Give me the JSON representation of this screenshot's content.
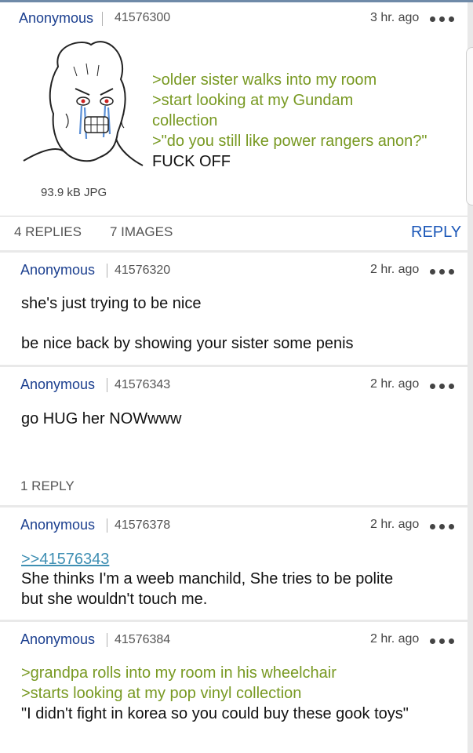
{
  "op": {
    "name": "Anonymous",
    "post_id": "41576300",
    "time": "3 hr. ago",
    "lines": [
      ">older sister walks into my room",
      ">start looking at my Gundam",
      "collection",
      ">\"do you still like power rangers anon?\"",
      "FUCK OFF"
    ],
    "file_info": "93.9 kB JPG",
    "replies": "4 REPLIES",
    "images": "7 IMAGES",
    "reply_label": "REPLY"
  },
  "posts": [
    {
      "name": "Anonymous",
      "post_id": "41576320",
      "time": "2 hr. ago",
      "lines": [
        "she's just trying to be nice",
        "be nice back by showing your sister some penis"
      ]
    },
    {
      "name": "Anonymous",
      "post_id": "41576343",
      "time": "2 hr. ago",
      "lines": [
        "go HUG her NOWwww"
      ],
      "replies": "1 REPLY"
    },
    {
      "name": "Anonymous",
      "post_id": "41576378",
      "time": "2 hr. ago",
      "quote_link": ">>41576343",
      "lines": [
        "She thinks I'm a weeb manchild, She tries to be polite",
        "but she wouldn't touch me."
      ]
    },
    {
      "name": "Anonymous",
      "post_id": "41576384",
      "time": "2 hr. ago",
      "lines": [
        ">grandpa rolls into my room in his wheelchair",
        ">starts looking at my pop vinyl collection",
        "\"I didn't fight in korea so you could buy these gook toys\""
      ]
    }
  ]
}
